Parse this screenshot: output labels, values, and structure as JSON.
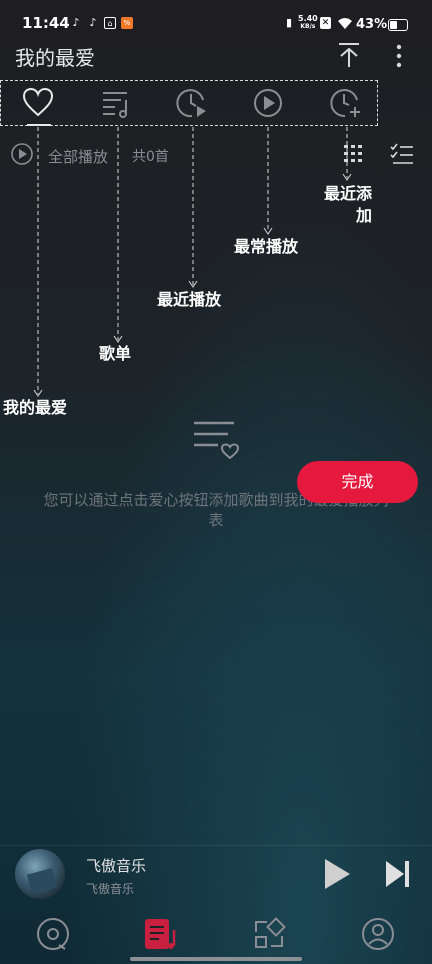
{
  "status_bar": {
    "time": "11:44",
    "net_speed_value": "5.40",
    "net_speed_unit": "KB/s",
    "battery": "43%"
  },
  "header": {
    "title": "我的最爱"
  },
  "tabs": [
    {
      "name": "heart-icon",
      "selected": true
    },
    {
      "name": "playlist-icon",
      "selected": false
    },
    {
      "name": "recent-play-icon",
      "selected": false
    },
    {
      "name": "most-played-icon",
      "selected": false
    },
    {
      "name": "recent-add-icon",
      "selected": false
    }
  ],
  "toolbar": {
    "play_all": "全部播放",
    "count": "共0首"
  },
  "annotations": {
    "recent_add_line1": "最近添",
    "recent_add_line2": "加",
    "most_played": "最常播放",
    "recent_played": "最近播放",
    "playlist": "歌单",
    "favorites": "我的最爱"
  },
  "empty_state": {
    "line1": "您可以通过点击爱心按钮添加歌曲到我的最爱播放列",
    "line2": "表"
  },
  "done_button": "完成",
  "player": {
    "song": "飞傲音乐",
    "artist": "飞傲音乐"
  },
  "colors": {
    "accent": "#e5183e",
    "nav_active": "#c8203e"
  }
}
